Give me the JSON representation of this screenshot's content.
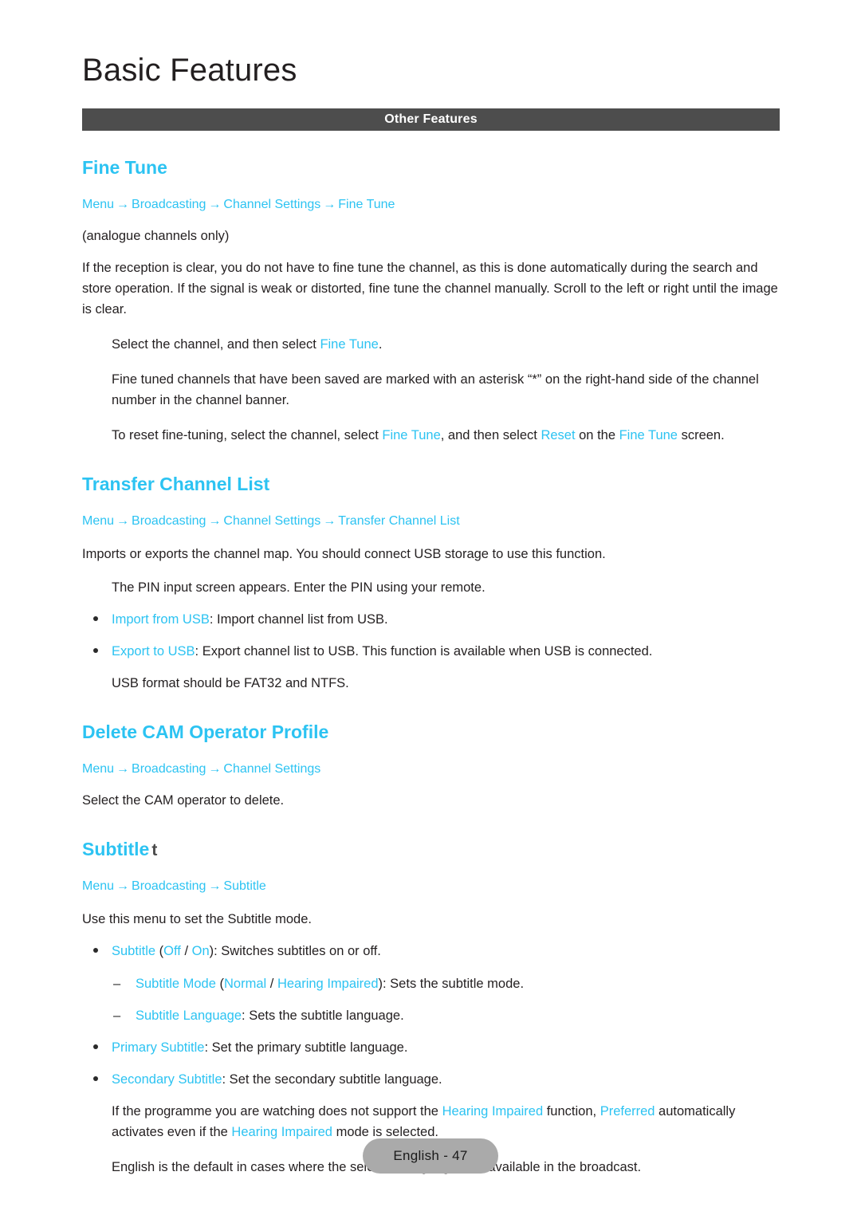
{
  "header": {
    "doc_title": "Basic Features",
    "section_bar_label": "Other Features",
    "bar_color": "#4d4d4d",
    "accent_color": "#2cc3f2"
  },
  "sections": {
    "fine_tune": {
      "heading": "Fine Tune",
      "breadcrumb": [
        "Menu",
        "Broadcasting",
        "Channel Settings",
        "Fine Tune"
      ],
      "note": "(analogue channels only)",
      "intro": "If the reception is clear, you do not have to fine tune the channel, as this is done automatically during the search and store operation. If the signal is weak or distorted, fine tune the channel manually. Scroll to the left or right until the image is clear.",
      "p1_a": "Select the channel, and then select ",
      "p1_link": "Fine Tune",
      "p1_b": ".",
      "p2": "Fine tuned channels that have been saved are marked with an asterisk “*” on the right-hand side of the channel number in the channel banner.",
      "p3_a": "To reset fine-tuning, select the channel, select ",
      "p3_link1": "Fine Tune",
      "p3_b": ", and then select ",
      "p3_link2": "Reset",
      "p3_c": " on the ",
      "p3_link3": "Fine Tune",
      "p3_d": " screen."
    },
    "transfer_channel_list": {
      "heading": "Transfer Channel List",
      "breadcrumb": [
        "Menu",
        "Broadcasting",
        "Channel Settings",
        "Transfer Channel List"
      ],
      "intro": "Imports or exports the channel map. You should connect USB storage to use this function.",
      "p1": "The PIN input screen appears. Enter the PIN using your remote.",
      "bullets": [
        {
          "term": "Import from USB",
          "rest": ": Import channel list from USB."
        },
        {
          "term": "Export to USB",
          "rest": ": Export channel list to USB. This function is available when USB is connected."
        }
      ],
      "p2": "USB format should be FAT32 and NTFS."
    },
    "delete_cam": {
      "heading": "Delete CAM Operator Profile",
      "breadcrumb": [
        "Menu",
        "Broadcasting",
        "Channel Settings"
      ],
      "intro": "Select the CAM operator to delete."
    },
    "subtitle": {
      "heading": "Subtitle",
      "heading_key_glyph": "t",
      "breadcrumb": [
        "Menu",
        "Broadcasting",
        "Subtitle"
      ],
      "intro": "Use this menu to set the Subtitle mode.",
      "b1_term": "Subtitle",
      "b1_paren_open": " (",
      "b1_opt1": "Off",
      "b1_slash": " / ",
      "b1_opt2": "On",
      "b1_rest": "): Switches subtitles on or off.",
      "s1_term": "Subtitle Mode",
      "s1_paren_open": " (",
      "s1_opt1": "Normal",
      "s1_slash": " / ",
      "s1_opt2": "Hearing Impaired",
      "s1_rest": "): Sets the subtitle mode.",
      "s2_term": "Subtitle Language",
      "s2_rest": ": Sets the subtitle language.",
      "b2_term": "Primary Subtitle",
      "b2_rest": ": Set the primary subtitle language.",
      "b3_term": "Secondary Subtitle",
      "b3_rest": ": Set the secondary subtitle language.",
      "p1_a": "If the programme you are watching does not support the ",
      "p1_link1": "Hearing Impaired",
      "p1_b": " function, ",
      "p1_link2": "Preferred",
      "p1_c": " automatically activates even if the ",
      "p1_link3": "Hearing Impaired",
      "p1_d": " mode is selected.",
      "p2": "English is the default in cases where the selected language is unavailable in the broadcast."
    }
  },
  "footer": {
    "page_label": "English - 47"
  }
}
